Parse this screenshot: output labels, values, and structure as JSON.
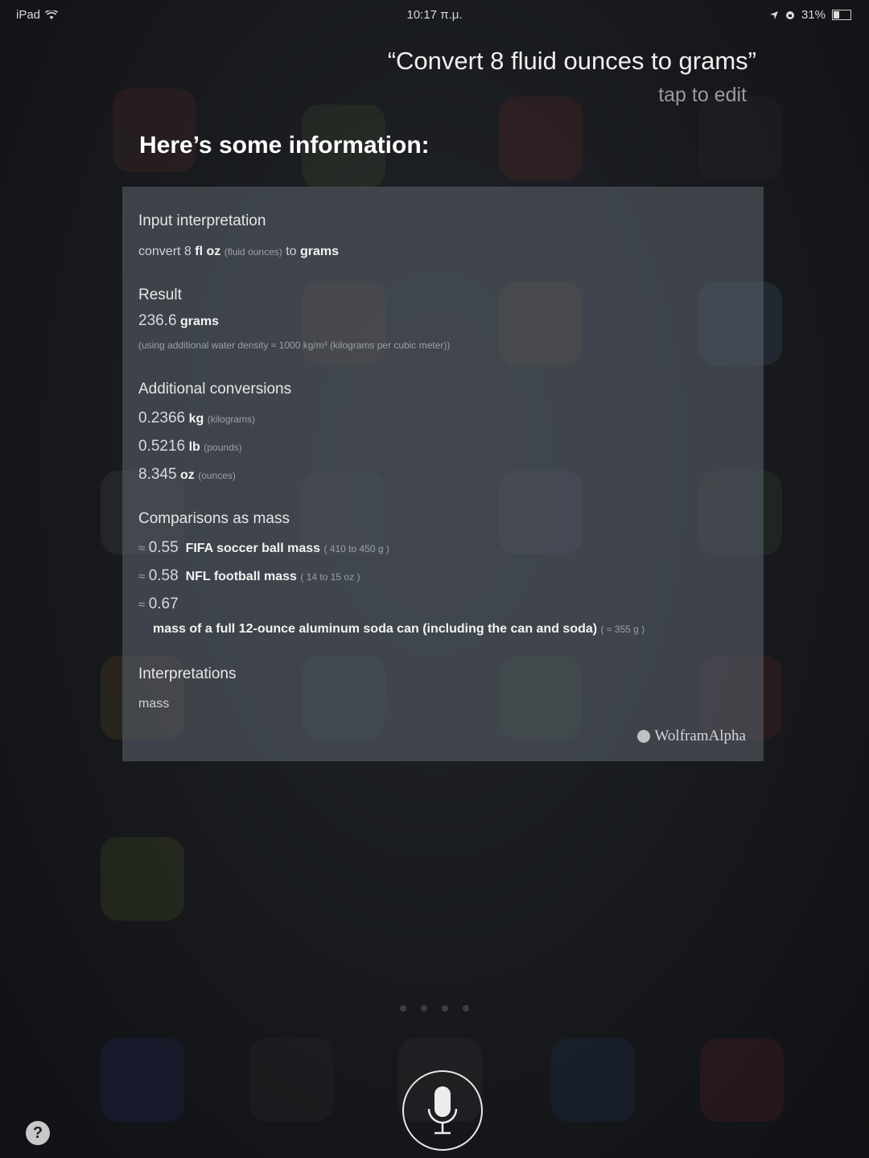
{
  "status_bar": {
    "device": "iPad",
    "time": "10:17 π.μ.",
    "battery": "31%",
    "battery_level": 0.31
  },
  "query": {
    "text": "“Convert 8 fluid ounces to grams”",
    "edit_hint": "tap to edit"
  },
  "heading": "Here’s some information:",
  "card": {
    "input_interpretation": {
      "title": "Input interpretation",
      "prefix": "convert 8",
      "unit": "fl oz",
      "unit_note": "(fluid ounces)",
      "to_word": "to",
      "target": "grams"
    },
    "result": {
      "title": "Result",
      "value": "236.6",
      "unit": "grams",
      "note": "(using additional water density ≈ 1000 kg/m³ (kilograms per cubic meter))"
    },
    "additional_conversions": {
      "title": "Additional conversions",
      "items": [
        {
          "value": "0.2366",
          "unit": "kg",
          "note": "(kilograms)"
        },
        {
          "value": "0.5216",
          "unit": "lb",
          "note": "(pounds)"
        },
        {
          "value": "8.345",
          "unit": "oz",
          "note": "(ounces)"
        }
      ]
    },
    "comparisons": {
      "title": "Comparisons as mass",
      "items": [
        {
          "prefix": "≈",
          "value": "0.55",
          "label": "FIFA soccer ball mass",
          "note": "( 410 to 450 g )"
        },
        {
          "prefix": "≈",
          "value": "0.58",
          "label": "NFL football mass",
          "note": "( 14 to 15 oz )"
        },
        {
          "prefix": "≈",
          "value": "0.67",
          "label": "mass of a full 12-ounce aluminum soda can (including the can and soda)",
          "note": "( ≈ 355 g )"
        }
      ]
    },
    "interpretations": {
      "title": "Interpretations",
      "value": "mass"
    },
    "logo": "WolframAlpha"
  },
  "controls": {
    "help_label": "?",
    "mic_icon": "microphone-icon"
  }
}
